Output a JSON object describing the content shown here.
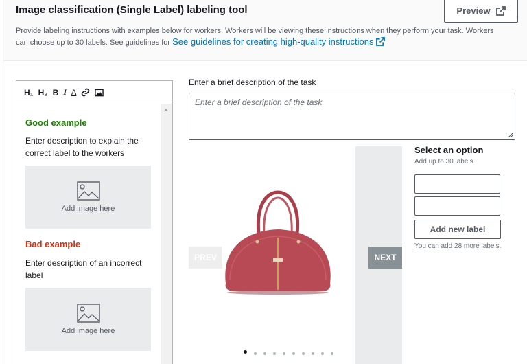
{
  "header": {
    "title": "Image classification (Single Label) labeling tool",
    "preview_label": "Preview",
    "description": "Provide labeling instructions with examples below for workers. Workers will be viewing these instructions when they perform your task. Workers can choose up to 30 labels. See guidelines for",
    "guidelines_link": "See guidelines for creating high-quality instructions"
  },
  "editor": {
    "toolbar": {
      "h1": "H₁",
      "h2": "H₂",
      "bold": "B",
      "italic": "I",
      "font_color": "A"
    },
    "good_heading": "Good example",
    "good_text": "Enter description to explain the correct label to the workers",
    "good_image_label": "Add image here",
    "bad_heading": "Bad example",
    "bad_text": "Enter description of an incorrect label",
    "bad_image_label": "Add image here"
  },
  "task": {
    "label": "Enter a brief description of the task",
    "placeholder": "Enter a brief description of the task"
  },
  "carousel": {
    "prev_label": "PREV",
    "next_label": "NEXT",
    "dot_count": 10,
    "active_dot": 1,
    "icons": [
      "handbag-image"
    ]
  },
  "options": {
    "title": "Select an option",
    "subtitle": "Add up to 30 labels",
    "inputs": [
      "",
      ""
    ],
    "add_label": "Add new label",
    "remaining": "You can add 28 more labels."
  },
  "colors": {
    "link": "#0073bb",
    "good": "#1d8102",
    "bad": "#d13212",
    "bag": "#b84a55"
  }
}
